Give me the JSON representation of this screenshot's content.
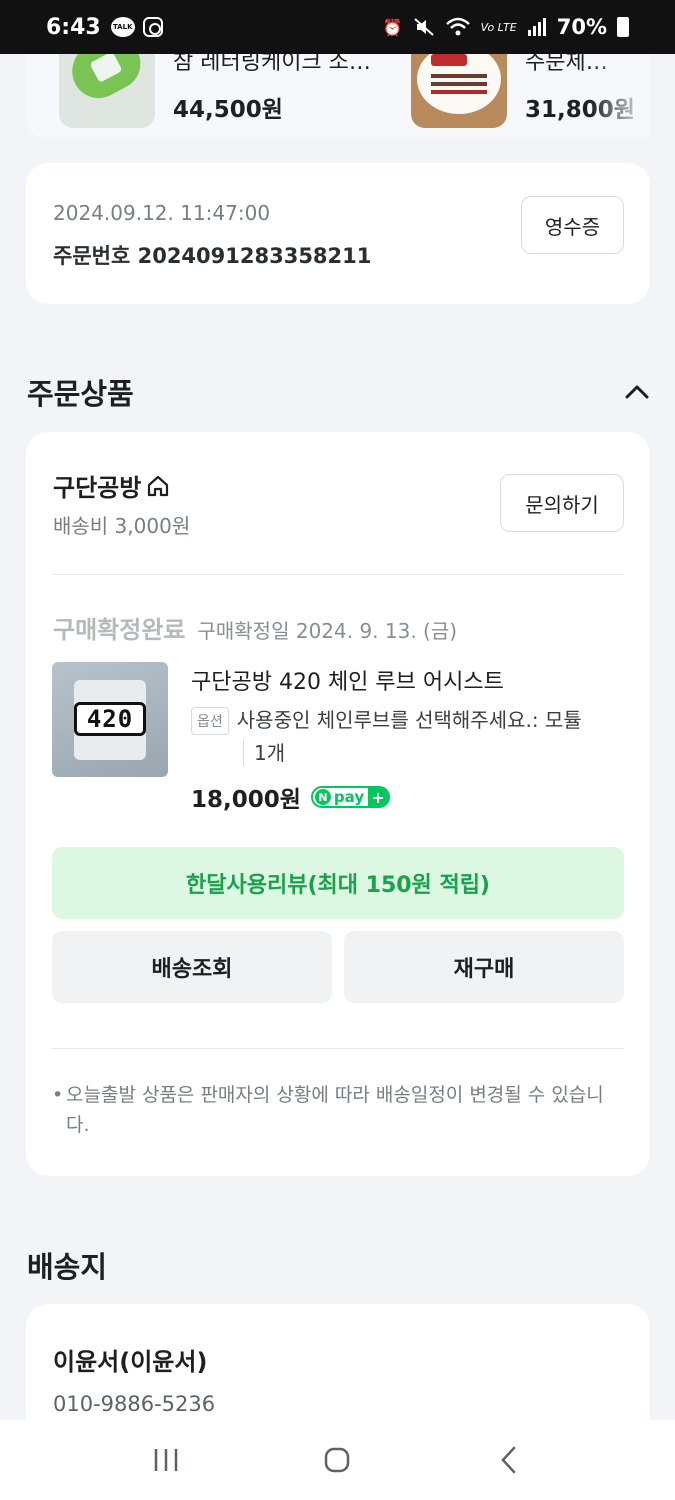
{
  "status_bar": {
    "time": "6:43",
    "talk_label": "TALK",
    "signal_label": "Vo LTE",
    "battery": "70%"
  },
  "recommendations": [
    {
      "name": "참 레터링케이크 소주병",
      "price": "44,500원",
      "image": "soju-bottle-cake"
    },
    {
      "name": "주문제작케이크",
      "price": "31,800원",
      "image": "lettering-cake"
    }
  ],
  "order": {
    "date": "2024.09.12. 11:47:00",
    "number": "주문번호 2024091283358211",
    "receipt_label": "영수증"
  },
  "order_items": {
    "title": "주문상품",
    "seller_name": "구단공방",
    "shipping_fee": "배송비 3,000원",
    "inquiry_label": "문의하기",
    "status": "구매확정완료",
    "confirm_date": "구매확정일 2024. 9. 13. (금)",
    "product": {
      "name": "구단공방 420 체인 루브 어시스트",
      "thumb_text": "420",
      "option_tag": "옵션",
      "option_text": "사용중인 체인루브를 선택해주세요.: 모튤",
      "quantity": "1개",
      "price": "18,000원",
      "npay_n": "N",
      "npay_label": "pay",
      "npay_plus": "+"
    },
    "review_button": "한달사용리뷰(최대 150원 적립)",
    "track_button": "배송조회",
    "rebuy_button": "재구매",
    "notice_bullet": "•",
    "notice": "오늘출발 상품은 판매자의 상황에 따라 배송일정이 변경될 수 있습니다."
  },
  "shipping": {
    "title": "배송지",
    "recipient": "이윤서(이윤서)",
    "phone": "010-9886-5236"
  },
  "colors": {
    "page_bg": "#f3f4f8",
    "accent_green": "#16a34a",
    "review_bg": "#dcf7e2",
    "npay_green": "#03c75a"
  }
}
